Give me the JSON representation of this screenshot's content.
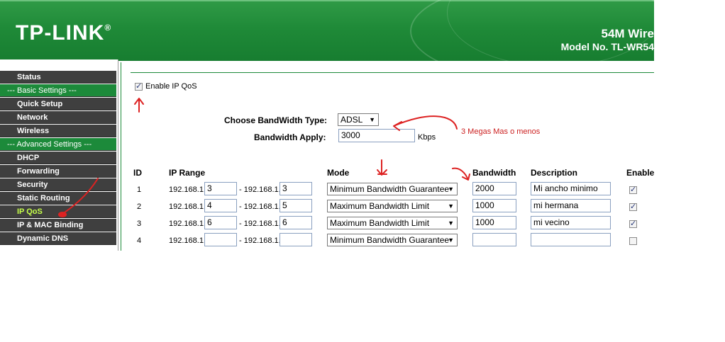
{
  "header": {
    "logo": "TP-LINK",
    "logo_mark": "®",
    "product": "54M Wire",
    "model": "Model No. TL-WR54"
  },
  "sidebar": {
    "items": [
      {
        "label": "Status",
        "type": "item"
      },
      {
        "label": "--- Basic Settings ---",
        "type": "section"
      },
      {
        "label": "Quick Setup",
        "type": "item"
      },
      {
        "label": "Network",
        "type": "item"
      },
      {
        "label": "Wireless",
        "type": "item"
      },
      {
        "label": "--- Advanced Settings ---",
        "type": "section"
      },
      {
        "label": "DHCP",
        "type": "item"
      },
      {
        "label": "Forwarding",
        "type": "item"
      },
      {
        "label": "Security",
        "type": "item"
      },
      {
        "label": "Static Routing",
        "type": "item"
      },
      {
        "label": "IP QoS",
        "type": "item",
        "active": true
      },
      {
        "label": "IP & MAC Binding",
        "type": "item"
      },
      {
        "label": "Dynamic DNS",
        "type": "item"
      }
    ]
  },
  "qos": {
    "enable_label": "Enable IP QoS",
    "enabled": true,
    "bandwidth_type_label": "Choose BandWidth Type:",
    "bandwidth_type": "ADSL",
    "bandwidth_apply_label": "Bandwidth Apply:",
    "bandwidth_apply": "3000",
    "unit": "Kbps"
  },
  "annotation": "3 Megas Mas o menos",
  "table": {
    "headers": {
      "id": "ID",
      "ip_range": "IP Range",
      "mode": "Mode",
      "bandwidth": "Bandwidth",
      "description": "Description",
      "enable": "Enable"
    },
    "rows": [
      {
        "id": "1",
        "prefix": "192.168.1.",
        "sep": "- 192.168.1.",
        "start": "3",
        "end": "3",
        "mode": "Minimum Bandwidth Guarantee",
        "bandwidth": "2000",
        "description": "Mi ancho minimo",
        "enabled": true
      },
      {
        "id": "2",
        "prefix": "192.168.1.",
        "sep": "- 192.168.1.",
        "start": "4",
        "end": "5",
        "mode": "Maximum Bandwidth Limit",
        "bandwidth": "1000",
        "description": "mi hermana",
        "enabled": true
      },
      {
        "id": "3",
        "prefix": "192.168.1.",
        "sep": "- 192.168.1.",
        "start": "6",
        "end": "6",
        "mode": "Maximum Bandwidth Limit",
        "bandwidth": "1000",
        "description": "mi vecino",
        "enabled": true
      },
      {
        "id": "4",
        "prefix": "192.168.1.",
        "sep": "- 192.168.1.",
        "start": "",
        "end": "",
        "mode": "Minimum Bandwidth Guarantee",
        "bandwidth": "",
        "description": "",
        "enabled": false
      }
    ]
  },
  "colors": {
    "header_green": "#1f8a38",
    "sidebar_dark": "#3f3f3f",
    "section_green": "#1c8a3a",
    "active_item": "#c6ff4a",
    "annotation_red": "#cc2222"
  }
}
